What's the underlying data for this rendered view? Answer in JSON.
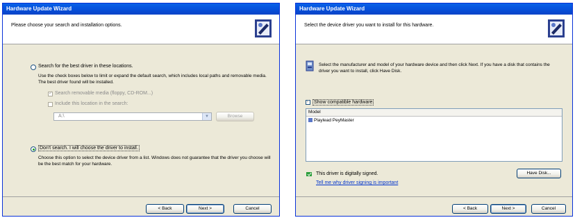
{
  "left_window": {
    "title": "Hardware Update Wizard",
    "header_text": "Please choose your search and installation options.",
    "radio_search_label": "Search for the best driver in these locations.",
    "search_description": "Use the check boxes below to limit or expand the default search, which includes local paths and removable media. The best driver found will be installed.",
    "check_removable_label": "Search removable media (floppy, CD-ROM...)",
    "check_include_location_label": "Include this location in the search:",
    "location_value": "A:\\",
    "browse_label": "Browse",
    "radio_dont_search_label": "Don't search. I will choose the driver to install.",
    "dont_search_description": "Choose this option to select the device driver from a list. Windows does not guarantee that the driver you choose will be the best match for your hardware.",
    "back_label": "< Back",
    "next_label": "Next >",
    "cancel_label": "Cancel"
  },
  "right_window": {
    "title": "Hardware Update Wizard",
    "header_text": "Select the device driver you want to install for this hardware.",
    "info_text": "Select the manufacturer and model of your hardware device and then click Next. If you have a disk that contains the driver you want to install, click Have Disk.",
    "show_compatible_label": "Show compatible hardware",
    "column_model": "Model",
    "model_item": "Playlead PeyMaster",
    "signed_text": "This driver is digitally signed.",
    "signing_link": "Tell me why driver signing is important",
    "have_disk_label": "Have Disk...",
    "back_label": "< Back",
    "next_label": "Next >",
    "cancel_label": "Cancel"
  }
}
